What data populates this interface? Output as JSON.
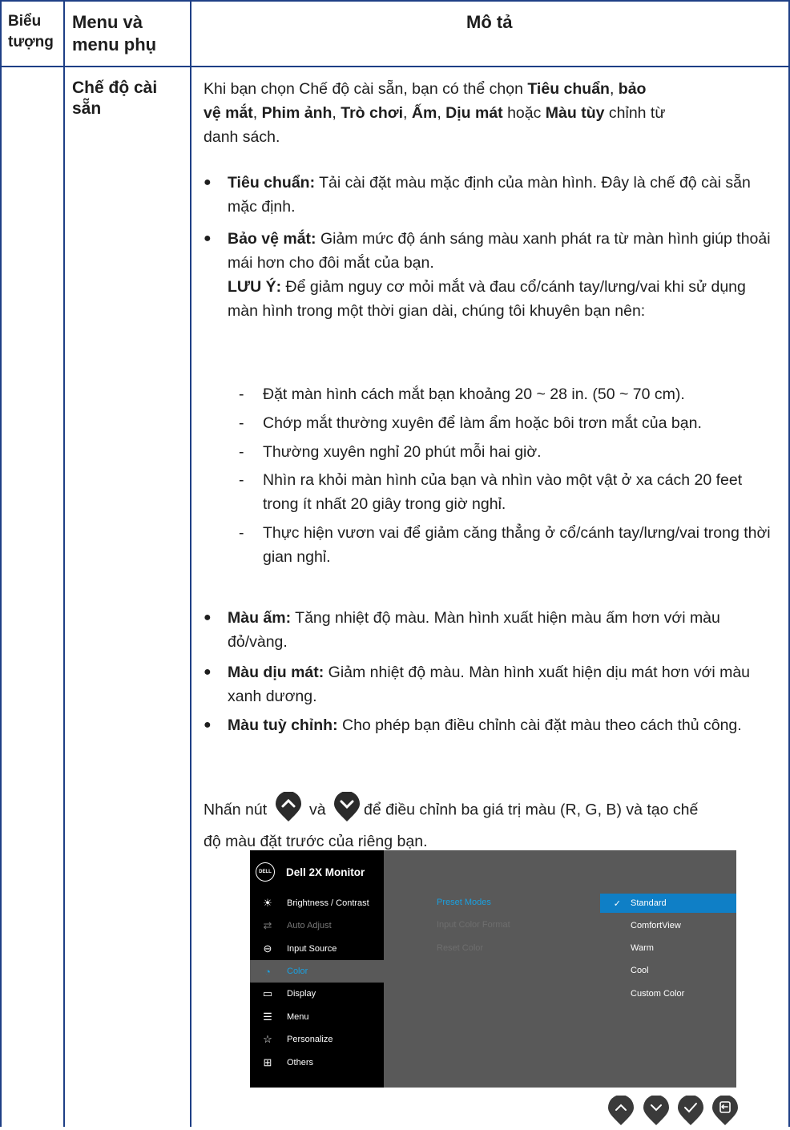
{
  "header": {
    "col1": [
      "Biểu",
      "tượng"
    ],
    "col2": [
      "Menu và",
      "menu phụ"
    ],
    "col3": "Mô tả"
  },
  "row": {
    "menu_name": [
      "Chế độ cài",
      "sẵn"
    ],
    "intro": {
      "t1": "Khi bạn chọn Chế độ cài sẵn, bạn có thể chọn ",
      "b1": "Tiêu chuẩn",
      "t2": ", ",
      "b2": "bảo",
      "b2b": "vệ mắt",
      "t3": ", ",
      "b3": "Phim ảnh",
      "t4": ", ",
      "b4": "Trò chơi",
      "t5": ", ",
      "b5": "Ấm",
      "t6": ", ",
      "b6": "Dịu mát",
      "t7": " hoặc ",
      "b7": "Màu tùy",
      "t8": " chỉnh từ",
      "t9": "danh sách."
    },
    "bullets": [
      {
        "label": "Tiêu chuẩn:",
        "text": " Tải cài đặt màu mặc định của màn hình. Đây là chế độ cài sẵn mặc định."
      },
      {
        "label": "Bảo vệ mắt:",
        "text": " Giảm mức độ ánh sáng màu xanh phát ra từ màn hình giúp thoải mái hơn cho đôi mắt của bạn."
      },
      {
        "label": "Màu ấm:",
        "text": " Tăng nhiệt độ màu. Màn hình xuất hiện màu ấm hơn với màu đỏ/vàng."
      },
      {
        "label": "Màu dịu mát:",
        "text": " Giảm nhiệt độ màu. Màn hình xuất hiện dịu mát hơn với màu xanh dương."
      },
      {
        "label": "Màu tuỳ chỉnh:",
        "text": " Cho phép bạn điều chỉnh cài đặt màu theo cách thủ công."
      }
    ],
    "note": {
      "label": "LƯU Ý:",
      "text": " Để giảm nguy cơ mỏi mắt và đau cổ/cánh tay/lưng/vai khi sử dụng màn hình trong một thời gian dài, chúng tôi khuyên bạn nên:"
    },
    "tips": [
      "Đặt màn hình cách mắt bạn khoảng 20 ~ 28 in. (50 ~ 70 cm).",
      "Chớp mắt thường xuyên để làm ẩm hoặc bôi trơn mắt của bạn.",
      "Thường xuyên nghỉ 20 phút mỗi hai giờ.",
      "Nhìn ra khỏi màn hình của bạn và nhìn vào một vật ở xa cách 20 feet trong ít nhất 20 giây trong giờ nghỉ.",
      "Thực hiện vươn vai để giảm căng thẳng ở cổ/cánh tay/lưng/vai trong thời gian nghỉ."
    ],
    "tip_dash": "-",
    "bullet_glyph": "●",
    "press": {
      "t1": "Nhấn nút",
      "t2": "và",
      "t3": "để điều chỉnh ba giá trị màu (R, G, B) và tạo chế",
      "t4": "độ màu đặt trước của riêng bạn."
    }
  },
  "osd": {
    "logo": "DELL",
    "title": "Dell 2X Monitor",
    "menu": [
      {
        "icon": "brightness-icon",
        "glyph": "☀",
        "label": "Brightness / Contrast",
        "state": "normal"
      },
      {
        "icon": "auto-adjust-icon",
        "glyph": "⇄",
        "label": "Auto Adjust",
        "state": "dim"
      },
      {
        "icon": "input-source-icon",
        "glyph": "⊖",
        "label": "Input Source",
        "state": "normal"
      },
      {
        "icon": "color-icon",
        "glyph": "◔",
        "label": "Color",
        "state": "active"
      },
      {
        "icon": "display-icon",
        "glyph": "▭",
        "label": "Display",
        "state": "normal"
      },
      {
        "icon": "menu-icon",
        "glyph": "☰",
        "label": "Menu",
        "state": "normal"
      },
      {
        "icon": "personalize-icon",
        "glyph": "☆",
        "label": "Personalize",
        "state": "normal"
      },
      {
        "icon": "others-icon",
        "glyph": "⊞",
        "label": "Others",
        "state": "normal"
      }
    ],
    "submenu": [
      {
        "label": "Preset Modes",
        "color": "#1aa0e0"
      },
      {
        "label": "Input Color Format",
        "color": "#6e6e6e"
      },
      {
        "label": "Reset Color",
        "color": "#6e6e6e"
      }
    ],
    "options": [
      {
        "label": "Standard",
        "selected": true,
        "check": "✓"
      },
      {
        "label": "ComfortView",
        "selected": false,
        "check": ""
      },
      {
        "label": "Warm",
        "selected": false,
        "check": ""
      },
      {
        "label": "Cool",
        "selected": false,
        "check": ""
      },
      {
        "label": "Custom Color",
        "selected": false,
        "check": ""
      }
    ]
  },
  "colors": {
    "border": "#1e3f86",
    "osd_bg": "#595959",
    "osd_left": "#000000",
    "accent": "#1aa0e0",
    "selected": "#0f7fc6",
    "button": "#3a3a3a"
  }
}
